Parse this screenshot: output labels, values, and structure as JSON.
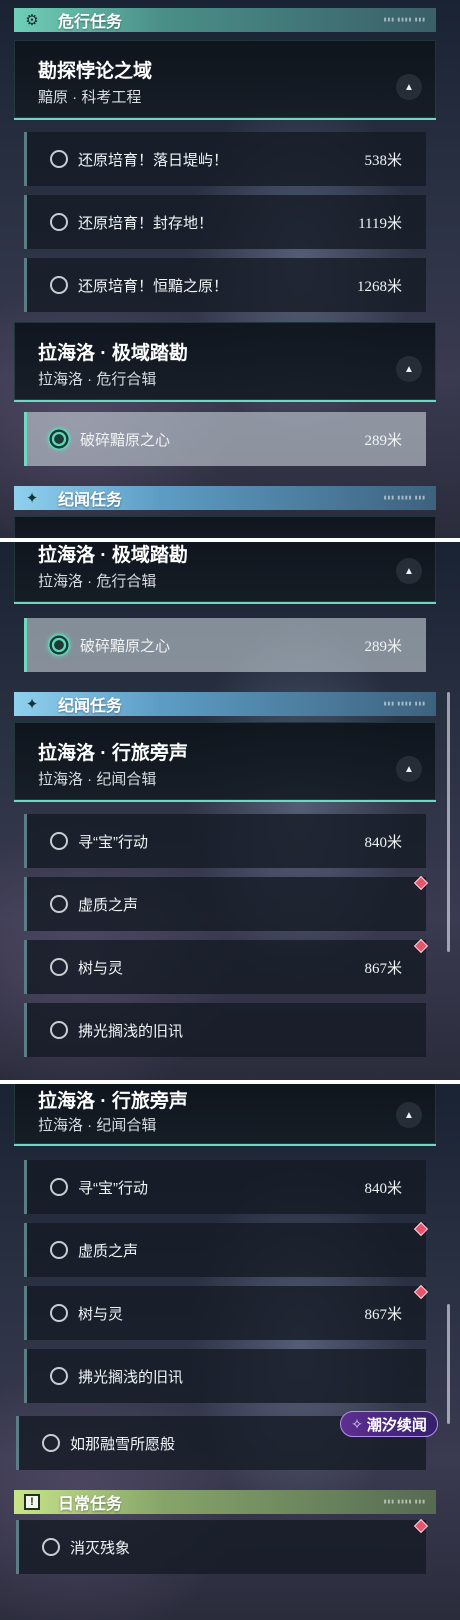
{
  "sections": {
    "danger": {
      "title": "危行任务",
      "icon": "⚙"
    },
    "story": {
      "title": "纪闻任务",
      "icon": "✦"
    },
    "daily": {
      "title": "日常任务",
      "icon": "!"
    }
  },
  "groups": {
    "g1": {
      "title": "勘探悖论之域",
      "subtitle": "黯原 · 科考工程"
    },
    "g2": {
      "title": "拉海洛 · 极域踏勘",
      "subtitle": "拉海洛 · 危行合辑"
    },
    "g3": {
      "title": "拉海洛 · 行旅旁声",
      "subtitle": "拉海洛 · 纪闻合辑"
    }
  },
  "tasks": {
    "t1": {
      "name": "还原培育！落日堤屿！",
      "distance": "538米"
    },
    "t2": {
      "name": "还原培育！封存地！",
      "distance": "1119米"
    },
    "t3": {
      "name": "还原培育！恒黯之原！",
      "distance": "1268米"
    },
    "t4": {
      "name": "破碎黯原之心",
      "distance": "289米"
    },
    "t5": {
      "name": "寻“宝”行动",
      "distance": "840米"
    },
    "t6": {
      "name": "虚质之声",
      "distance": ""
    },
    "t7": {
      "name": "树与灵",
      "distance": "867米"
    },
    "t8": {
      "name": "拂光搁浅的旧讯",
      "distance": ""
    },
    "t9": {
      "name": "如那融雪所愿般",
      "distance": ""
    },
    "t10": {
      "name": "消灭残象",
      "distance": ""
    }
  },
  "badge": {
    "label": "潮汐续闻"
  },
  "colors": {
    "accent": "#6fd7c2",
    "marker": "#e5566e",
    "badge": "#5d2f91"
  }
}
